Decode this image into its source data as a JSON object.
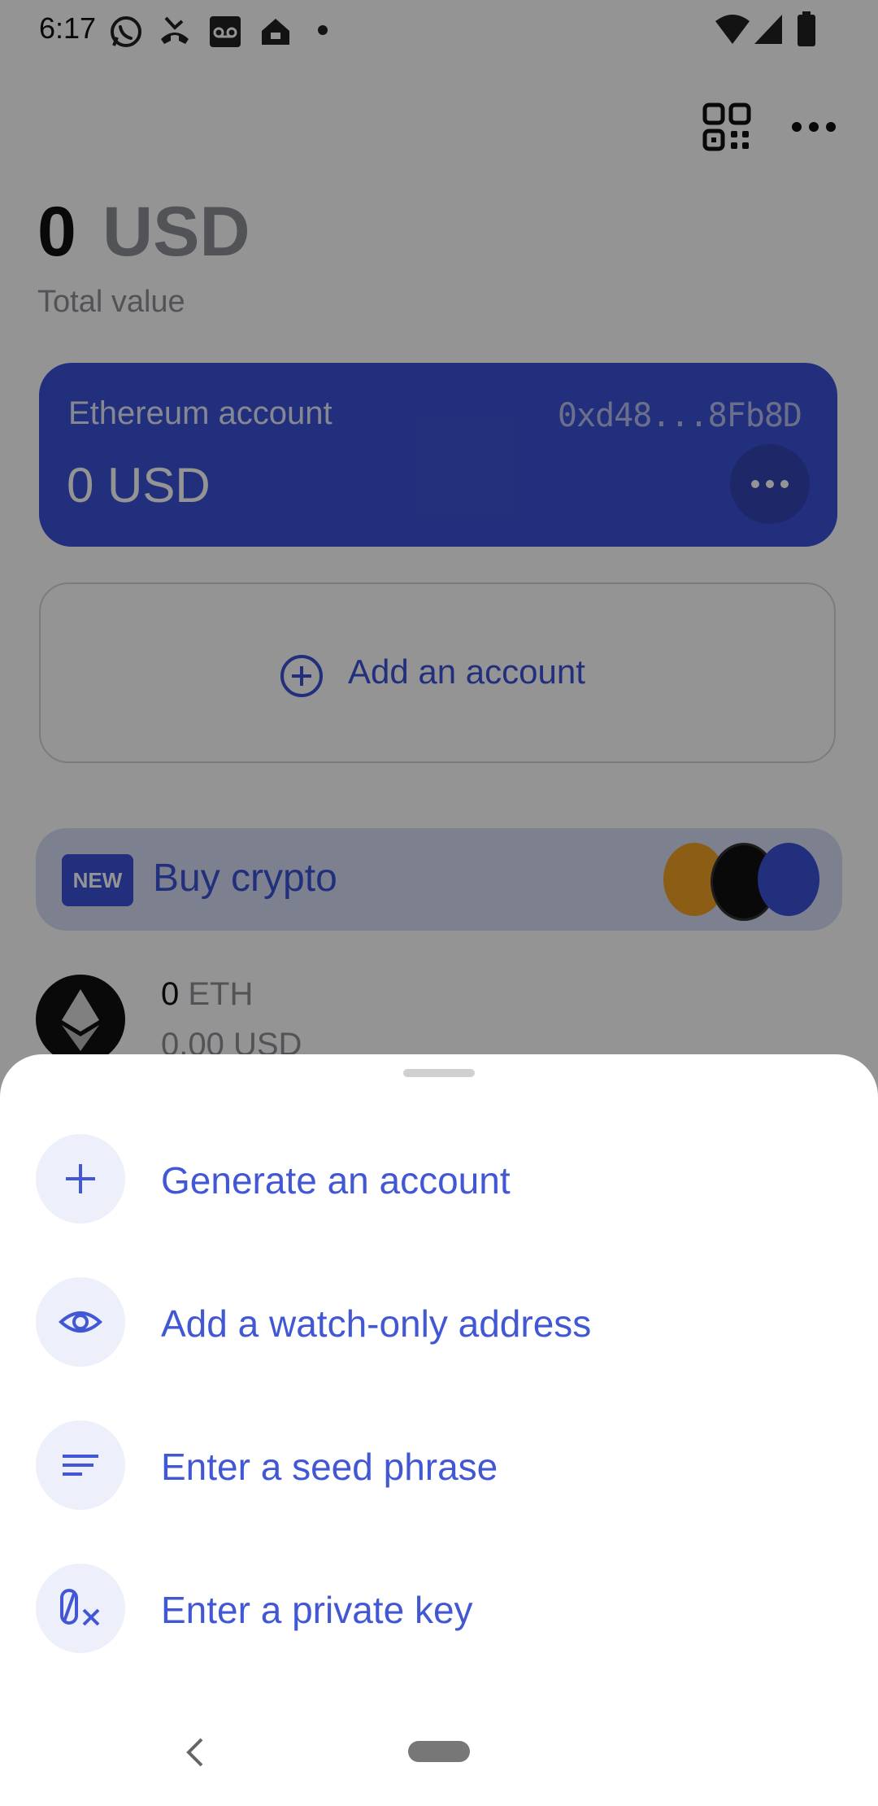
{
  "status_bar": {
    "time": "6:17",
    "icons": [
      "whatsapp-icon",
      "missed-call-icon",
      "voicemail-icon",
      "home-icon",
      "dot-icon",
      "wifi-icon",
      "signal-icon",
      "battery-icon"
    ]
  },
  "header": {
    "qr_icon": "qr-code-icon",
    "menu_icon": "more-horizontal-icon"
  },
  "total": {
    "amount": "0",
    "currency": "USD",
    "label": "Total value"
  },
  "account_card": {
    "name": "Ethereum account",
    "address": "0xd48...8Fb8D",
    "value": "0 USD",
    "color": "#3c52d6"
  },
  "add_account": {
    "label": "Add an account"
  },
  "buy_banner": {
    "badge": "NEW",
    "label": "Buy crypto"
  },
  "asset": {
    "amount": "0",
    "unit": "ETH",
    "usd": "0.00 USD"
  },
  "sheet": {
    "options": [
      {
        "label": "Generate an account",
        "icon": "plus-icon"
      },
      {
        "label": "Add a watch-only address",
        "icon": "eye-icon"
      },
      {
        "label": "Enter a seed phrase",
        "icon": "lines-icon"
      },
      {
        "label": "Enter a private key",
        "icon": "key-icon"
      }
    ]
  },
  "colors": {
    "accent": "#4157d3",
    "icon_circle": "#edf0fb"
  }
}
